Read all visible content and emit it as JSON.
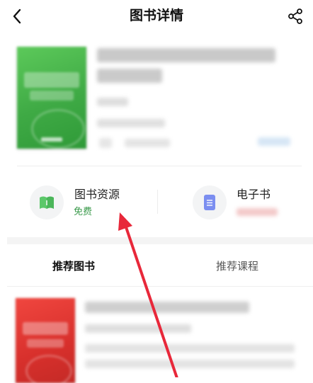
{
  "nav": {
    "title": "图书详情",
    "back_icon": "chevron-left-icon",
    "share_icon": "share-icon"
  },
  "book": {
    "cover_color": "#4cbb4e"
  },
  "resources": [
    {
      "title": "图书资源",
      "subtitle": "免费",
      "subtitle_color": "#3a9a4b",
      "icon": "open-book-icon",
      "icon_color": "#5cc86a"
    },
    {
      "title": "电子书",
      "subtitle": "",
      "icon": "ebook-icon",
      "icon_color": "#7b8ef0"
    }
  ],
  "tabs": [
    {
      "label": "推荐图书",
      "active": true
    },
    {
      "label": "推荐课程",
      "active": false
    }
  ],
  "recommended": {
    "cover_color": "#e03a34"
  },
  "colors": {
    "accent_green": "#3a9a4b",
    "annotation_red": "#e8283a",
    "active_tab": "#111111",
    "inactive_tab": "#555555"
  }
}
